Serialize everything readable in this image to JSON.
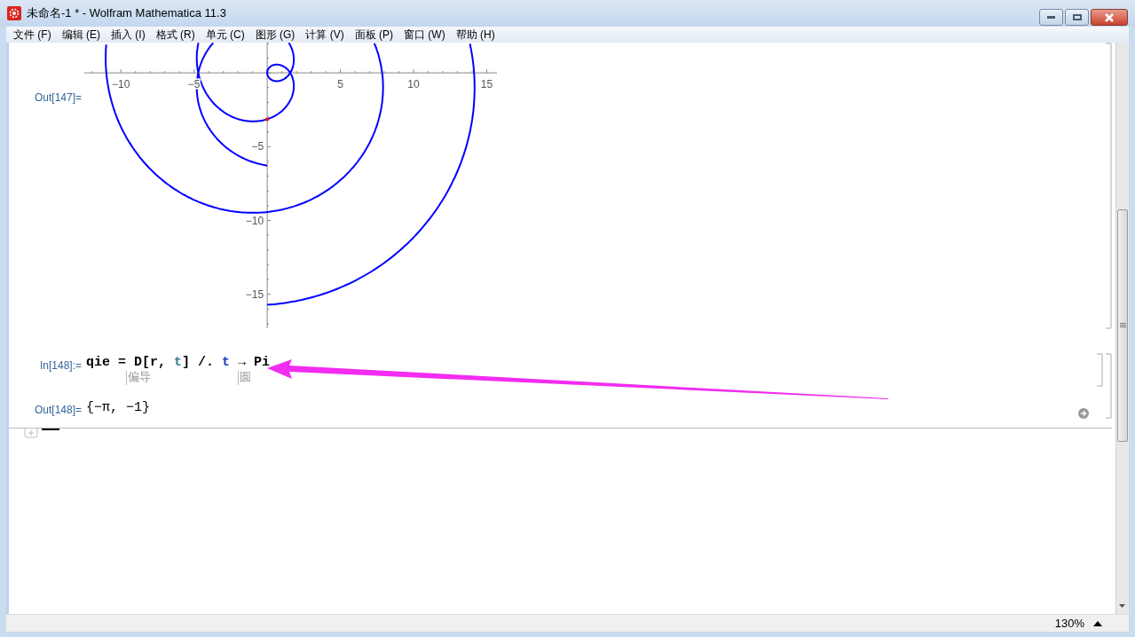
{
  "window": {
    "title": "未命名-1 * - Wolfram Mathematica 11.3"
  },
  "menu": [
    "文件 (F)",
    "编辑 (E)",
    "插入 (I)",
    "格式 (R)",
    "单元 (C)",
    "图形 (G)",
    "计算 (V)",
    "面板 (P)",
    "窗口 (W)",
    "帮助 (H)"
  ],
  "graphics_cell": {
    "label": "Out[147]=",
    "x_tick_labels": [
      "−10",
      "−5",
      "5",
      "10",
      "15"
    ],
    "y_tick_labels": [
      "−5",
      "−10",
      "−15"
    ]
  },
  "input_cell": {
    "label": "In[148]:=",
    "tokens": [
      {
        "text": "qie = D[",
        "color": "#000000"
      },
      {
        "text": "r",
        "color": "#000000"
      },
      {
        "text": ", ",
        "color": "#000000"
      },
      {
        "text": "t",
        "color": "#3b7f8f"
      },
      {
        "text": "] /. ",
        "color": "#000000"
      },
      {
        "text": "t",
        "color": "#1a3fbf"
      },
      {
        "text": " → Pi",
        "color": "#000000"
      }
    ],
    "hints": [
      "偏导",
      "圆"
    ]
  },
  "output_cell": {
    "label": "Out[148]=",
    "text": "{−π, −1}"
  },
  "status_bar": {
    "zoom": "130%"
  }
}
